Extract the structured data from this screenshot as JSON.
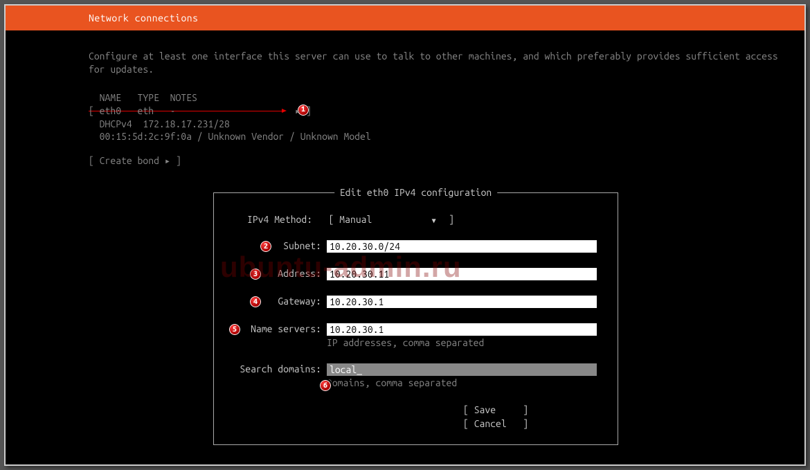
{
  "header": {
    "title": "Network connections"
  },
  "description": "Configure at least one interface this server can use to talk to other machines, and which preferably provides sufficient access for updates.",
  "columns": "  NAME   TYPE  NOTES",
  "iface": {
    "row": "[ eth0   eth   -                      ▸ ]",
    "dhcp": "  DHCPv4  172.18.17.231/28",
    "mac": "  00:15:5d:2c:9f:0a / Unknown Vendor / Unknown Model"
  },
  "bond": "[ Create bond ▸ ]",
  "dialog": {
    "title": " Edit eth0 IPv4 configuration ",
    "method_label": "IPv4 Method:",
    "method_value": "Manual",
    "fields": {
      "subnet": {
        "label": "Subnet:",
        "value": "10.20.30.0/24"
      },
      "address": {
        "label": "Address:",
        "value": "10.20.30.11"
      },
      "gateway": {
        "label": "Gateway:",
        "value": "10.20.30.1"
      },
      "nameservers": {
        "label": "Name servers:",
        "value": "10.20.30.1",
        "hint": "IP addresses, comma separated"
      },
      "searchdomains": {
        "label": "Search domains:",
        "value": "local_",
        "hint": "Domains, comma separated"
      }
    },
    "buttons": {
      "save": "Save",
      "cancel": "Cancel"
    }
  },
  "annotations": {
    "b1": "1",
    "b2": "2",
    "b3": "3",
    "b4": "4",
    "b5": "5",
    "b6": "6"
  },
  "watermark": "ubuntu-admin.ru"
}
